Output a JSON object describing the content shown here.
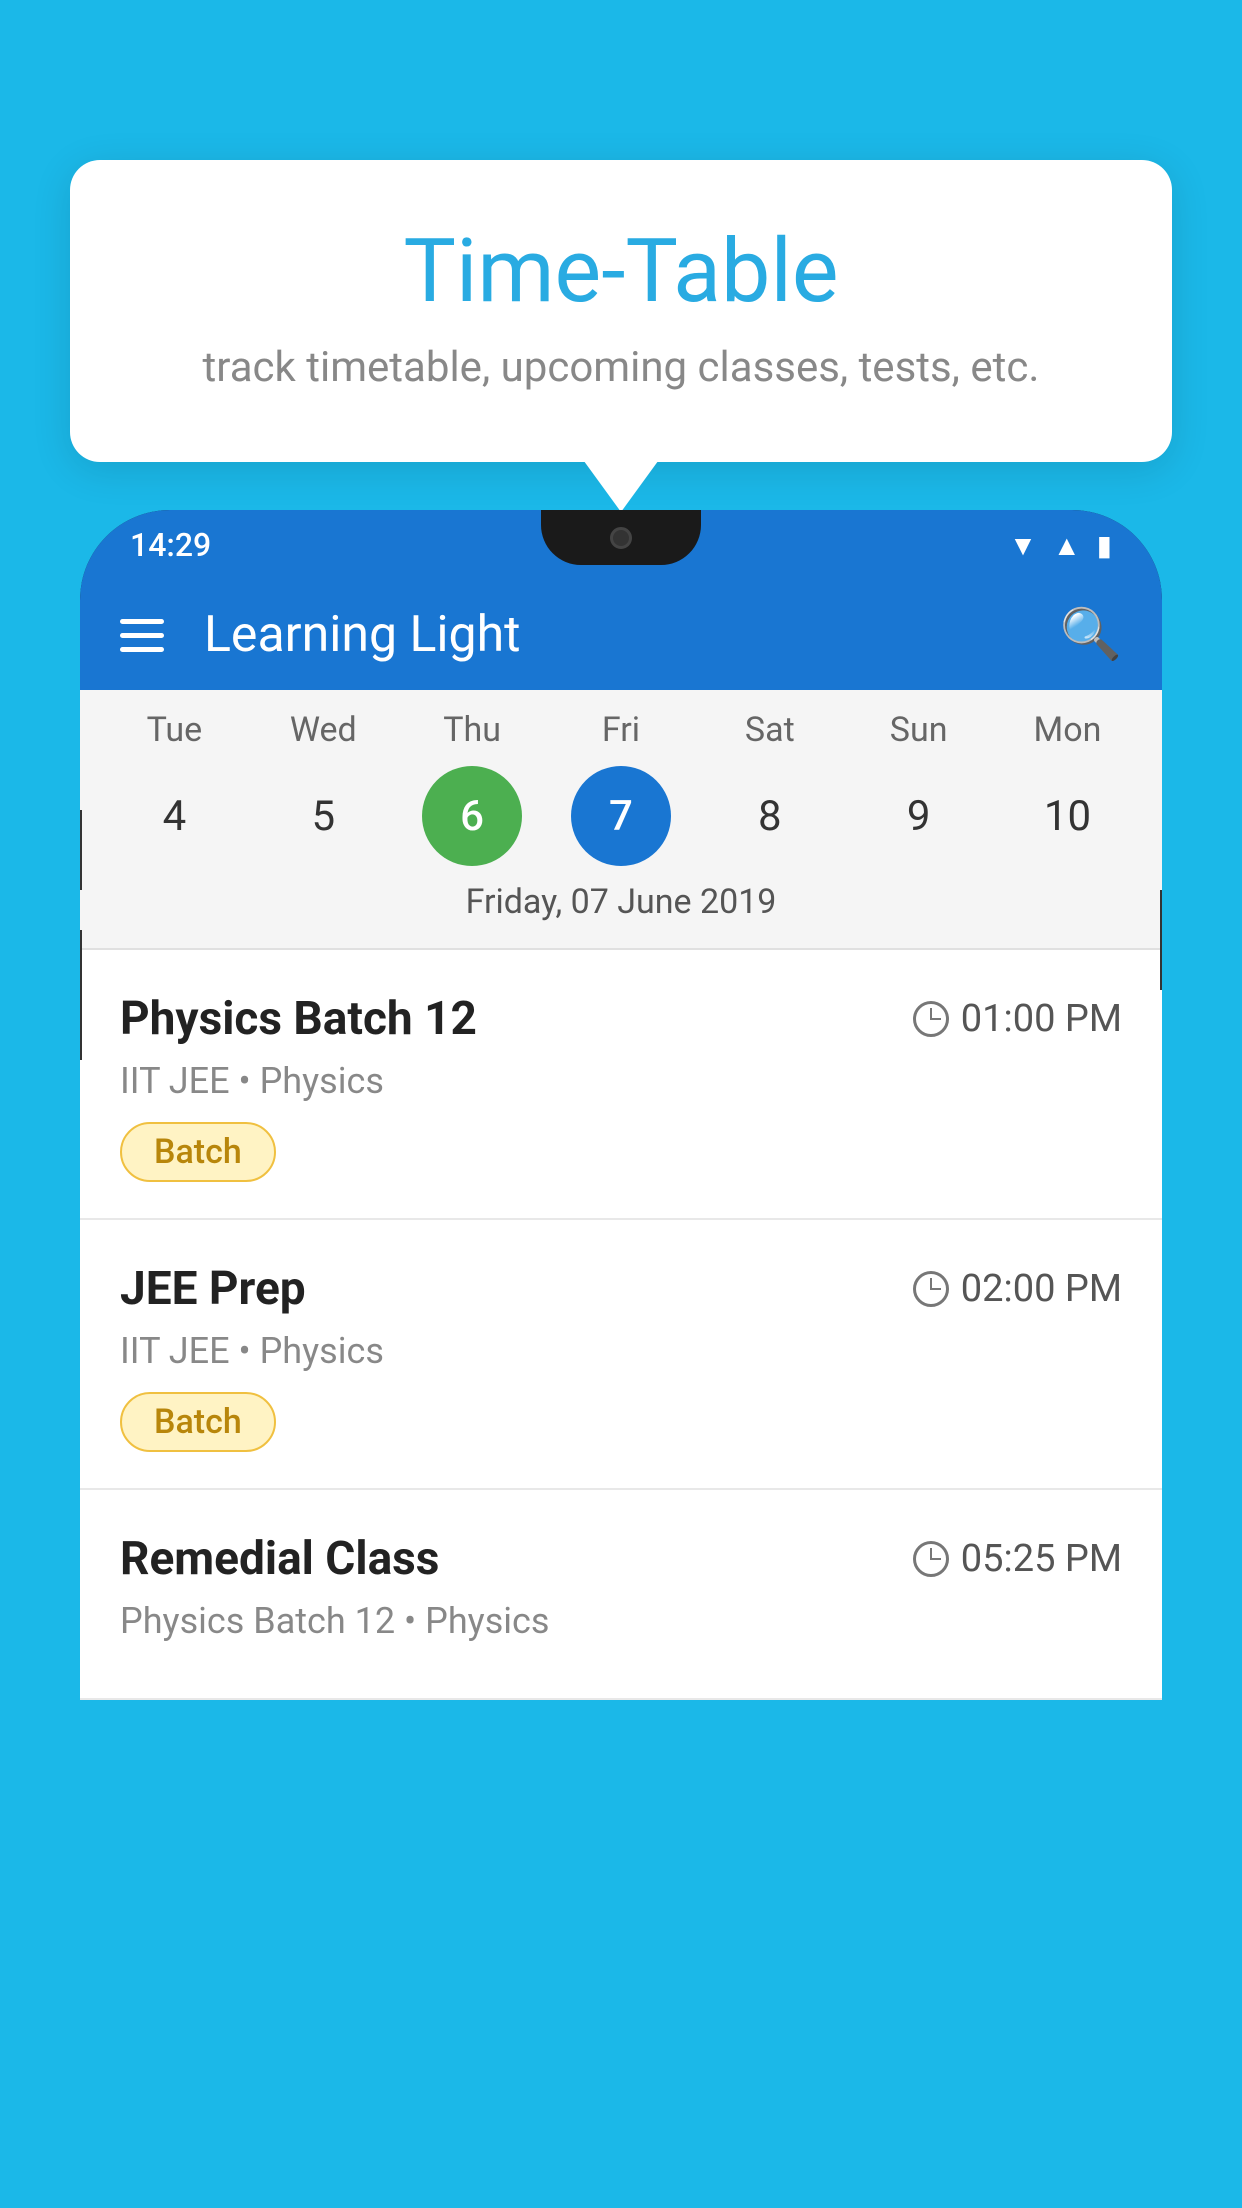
{
  "background_color": "#1BB8E8",
  "tooltip": {
    "title": "Time-Table",
    "subtitle": "track timetable, upcoming classes, tests, etc."
  },
  "app": {
    "title": "Learning Light",
    "status_time": "14:29"
  },
  "calendar": {
    "selected_date_label": "Friday, 07 June 2019",
    "days": [
      {
        "name": "Tue",
        "num": "4",
        "state": "normal"
      },
      {
        "name": "Wed",
        "num": "5",
        "state": "normal"
      },
      {
        "name": "Thu",
        "num": "6",
        "state": "today"
      },
      {
        "name": "Fri",
        "num": "7",
        "state": "selected"
      },
      {
        "name": "Sat",
        "num": "8",
        "state": "normal"
      },
      {
        "name": "Sun",
        "num": "9",
        "state": "normal"
      },
      {
        "name": "Mon",
        "num": "10",
        "state": "normal"
      }
    ]
  },
  "schedule": [
    {
      "class_name": "Physics Batch 12",
      "time": "01:00 PM",
      "subtitle": "IIT JEE • Physics",
      "badge": "Batch"
    },
    {
      "class_name": "JEE Prep",
      "time": "02:00 PM",
      "subtitle": "IIT JEE • Physics",
      "badge": "Batch"
    },
    {
      "class_name": "Remedial Class",
      "time": "05:25 PM",
      "subtitle": "Physics Batch 12 • Physics",
      "badge": ""
    }
  ],
  "labels": {
    "hamburger": "☰",
    "search": "🔍"
  }
}
